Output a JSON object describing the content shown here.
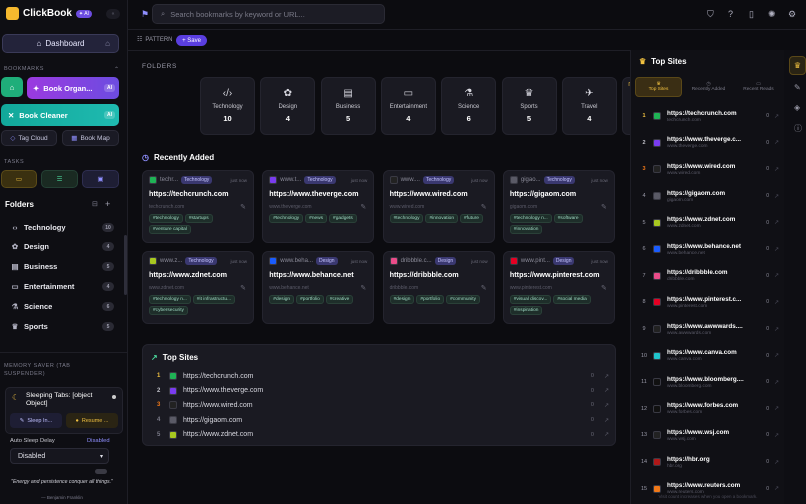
{
  "app": {
    "name": "ClickBook",
    "ai_badge": "✦ AI"
  },
  "sidebar": {
    "dashboard": "Dashboard",
    "bookmarks_label": "BOOKMARKS",
    "organizer": "Book Organ...",
    "cleaner": "Book Cleaner",
    "ai": "AI",
    "tag_cloud": "Tag Cloud",
    "book_map": "Book Map",
    "tasks_label": "TASKS",
    "folders_title": "Folders",
    "folders": [
      {
        "name": "Technology",
        "count": "10"
      },
      {
        "name": "Design",
        "count": "4"
      },
      {
        "name": "Business",
        "count": "5"
      },
      {
        "name": "Entertainment",
        "count": "4"
      },
      {
        "name": "Science",
        "count": "6"
      },
      {
        "name": "Sports",
        "count": "5"
      }
    ],
    "memory_label": "MEMORY SAVER (TAB SUSPENDER)",
    "sleeping_tabs": "Sleeping Tabs: [object Object]",
    "sleep_in": "Sleep In...",
    "resume": "Resume ...",
    "auto_sleep_label": "Auto Sleep Delay",
    "auto_sleep_value": "Disabled",
    "select_value": "Disabled",
    "quote": "\"Energy and persistence conquer all things.\"",
    "quote_author": "— Benjamin Franklin"
  },
  "topbar": {
    "search_placeholder": "Search bookmarks by keyword or URL..."
  },
  "toolbar": {
    "pattern": "PATTERN",
    "save": "+ Save"
  },
  "folders_section": {
    "title": "FOLDERS",
    "items": [
      {
        "name": "Technology",
        "count": "10",
        "icon": "code-icon"
      },
      {
        "name": "Design",
        "count": "4",
        "icon": "palette-icon"
      },
      {
        "name": "Business",
        "count": "5",
        "icon": "briefcase-icon"
      },
      {
        "name": "Entertainment",
        "count": "4",
        "icon": "tv-icon"
      },
      {
        "name": "Science",
        "count": "6",
        "icon": "flask-icon"
      },
      {
        "name": "Sports",
        "count": "5",
        "icon": "trophy-icon"
      },
      {
        "name": "Travel",
        "count": "4",
        "icon": "plane-icon"
      },
      {
        "name": "Other",
        "count": "1",
        "icon": "folder-icon"
      }
    ]
  },
  "recent": {
    "title": "Recently Added",
    "cards": [
      {
        "site": "techr...",
        "cat": "Technology",
        "time": "just now",
        "url": "https://techcrunch.com",
        "domain": "techcrunch.com",
        "tags": [
          "#technology",
          "#startups",
          "#venture capital"
        ],
        "color": "#1fb355"
      },
      {
        "site": "www.t...",
        "cat": "Technology",
        "time": "just now",
        "url": "https://www.theverge.com",
        "domain": "www.theverge.com",
        "tags": [
          "#technology",
          "#news",
          "#gadgets"
        ],
        "color": "#7a3cf0"
      },
      {
        "site": "www....",
        "cat": "Technology",
        "time": "just now",
        "url": "https://www.wired.com",
        "domain": "www.wired.com",
        "tags": [
          "#technology",
          "#innovation",
          "#future"
        ],
        "color": "#222"
      },
      {
        "site": "gigao...",
        "cat": "Technology",
        "time": "just now",
        "url": "https://gigaom.com",
        "domain": "gigaom.com",
        "tags": [
          "#technology n...",
          "#software",
          "#innovation"
        ],
        "color": "#5a5a66"
      },
      {
        "site": "www.z...",
        "cat": "Technology",
        "time": "just now",
        "url": "https://www.zdnet.com",
        "domain": "www.zdnet.com",
        "tags": [
          "#technology n...",
          "#it infrastructu...",
          "#cybersecurity"
        ],
        "color": "#a8c820"
      },
      {
        "site": "www.beha...",
        "cat": "Design",
        "time": "just now",
        "url": "https://www.behance.net",
        "domain": "www.behance.net",
        "tags": [
          "#design",
          "#portfolio",
          "#creative"
        ],
        "color": "#1a5cff"
      },
      {
        "site": "dribbble.c...",
        "cat": "Design",
        "time": "just now",
        "url": "https://dribbble.com",
        "domain": "dribbble.com",
        "tags": [
          "#design",
          "#portfolio",
          "#community"
        ],
        "color": "#ea4c89"
      },
      {
        "site": "www.pint...",
        "cat": "Design",
        "time": "just now",
        "url": "https://www.pinterest.com",
        "domain": "www.pinterest.com",
        "tags": [
          "#visual discov...",
          "#social media",
          "#inspiration"
        ],
        "color": "#e60023"
      }
    ]
  },
  "top_sites_main": {
    "title": "Top Sites",
    "items": [
      {
        "rank": "1",
        "url": "https://techcrunch.com",
        "views": "0",
        "color": "#1fb355"
      },
      {
        "rank": "2",
        "url": "https://www.theverge.com",
        "views": "0",
        "color": "#7a3cf0"
      },
      {
        "rank": "3",
        "url": "https://www.wired.com",
        "views": "0",
        "color": "#222"
      },
      {
        "rank": "4",
        "url": "https://gigaom.com",
        "views": "0",
        "color": "#5a5a66"
      },
      {
        "rank": "5",
        "url": "https://www.zdnet.com",
        "views": "0",
        "color": "#a8c820"
      }
    ]
  },
  "right_panel": {
    "title": "Top Sites",
    "tabs": [
      "Top Sites",
      "Recently Added",
      "Recent Reads"
    ],
    "items": [
      {
        "rank": "1",
        "url": "https://techcrunch.com",
        "domain": "techcrunch.com",
        "views": "0",
        "color": "#1fb355"
      },
      {
        "rank": "2",
        "url": "https://www.theverge.c...",
        "domain": "www.theverge.com",
        "views": "0",
        "color": "#7a3cf0"
      },
      {
        "rank": "3",
        "url": "https://www.wired.com",
        "domain": "www.wired.com",
        "views": "0",
        "color": "#222"
      },
      {
        "rank": "4",
        "url": "https://gigaom.com",
        "domain": "gigaom.com",
        "views": "0",
        "color": "#5a5a66"
      },
      {
        "rank": "5",
        "url": "https://www.zdnet.com",
        "domain": "www.zdnet.com",
        "views": "0",
        "color": "#a8c820"
      },
      {
        "rank": "6",
        "url": "https://www.behance.net",
        "domain": "www.behance.net",
        "views": "0",
        "color": "#1a5cff"
      },
      {
        "rank": "7",
        "url": "https://dribbble.com",
        "domain": "dribbble.com",
        "views": "0",
        "color": "#ea4c89"
      },
      {
        "rank": "8",
        "url": "https://www.pinterest.c...",
        "domain": "www.pinterest.com",
        "views": "0",
        "color": "#e60023"
      },
      {
        "rank": "9",
        "url": "https://www.awwwards....",
        "domain": "www.awwwards.com",
        "views": "0",
        "color": "#222"
      },
      {
        "rank": "10",
        "url": "https://www.canva.com",
        "domain": "www.canva.com",
        "views": "0",
        "color": "#20c4cb"
      },
      {
        "rank": "11",
        "url": "https://www.bloomberg....",
        "domain": "www.bloomberg.com",
        "views": "0",
        "color": "#111"
      },
      {
        "rank": "12",
        "url": "https://www.forbes.com",
        "domain": "www.forbes.com",
        "views": "0",
        "color": "#111"
      },
      {
        "rank": "13",
        "url": "https://www.wsj.com",
        "domain": "www.wsj.com",
        "views": "0",
        "color": "#222"
      },
      {
        "rank": "14",
        "url": "https://hbr.org",
        "domain": "hbr.org",
        "views": "0",
        "color": "#b01818"
      },
      {
        "rank": "15",
        "url": "https://www.reuters.com",
        "domain": "www.reuters.com",
        "views": "0",
        "color": "#f07818"
      }
    ],
    "footer": "Visit count increases when you open a bookmark."
  }
}
